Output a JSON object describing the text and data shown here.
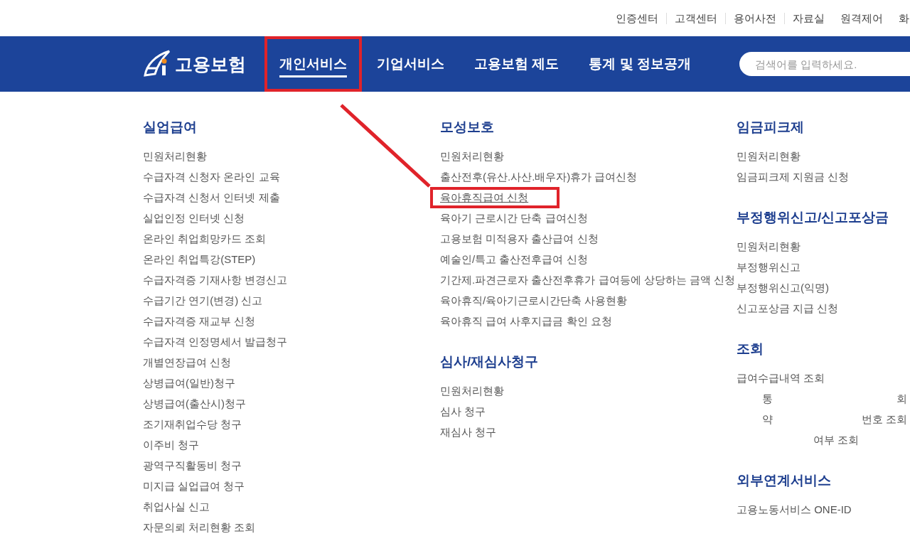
{
  "utility_links": [
    "인증센터",
    "고객센터",
    "용어사전",
    "자료실",
    "원격제어",
    "화"
  ],
  "header": {
    "logo": "고용보험",
    "nav": [
      {
        "label": "개인서비스",
        "selected": true,
        "highlighted": true
      },
      {
        "label": "기업서비스",
        "selected": false,
        "highlighted": false
      },
      {
        "label": "고용보험 제도",
        "selected": false,
        "highlighted": false
      },
      {
        "label": "통계 및 정보공개",
        "selected": false,
        "highlighted": false
      }
    ],
    "search": {
      "placeholder": "검색어를 입력하세요."
    }
  },
  "columns": [
    [
      {
        "title": "실업급여",
        "items": [
          {
            "label": "민원처리현황",
            "highlighted": false
          },
          {
            "label": "수급자격 신청자 온라인 교육",
            "highlighted": false
          },
          {
            "label": "수급자격 신청서 인터넷 제출",
            "highlighted": false
          },
          {
            "label": "실업인정 인터넷 신청",
            "highlighted": false
          },
          {
            "label": "온라인 취업희망카드 조회",
            "highlighted": false
          },
          {
            "label": "온라인 취업특강(STEP)",
            "highlighted": false
          },
          {
            "label": "수급자격증 기재사항 변경신고",
            "highlighted": false
          },
          {
            "label": "수급기간 연기(변경) 신고",
            "highlighted": false
          },
          {
            "label": "수급자격증 재교부 신청",
            "highlighted": false
          },
          {
            "label": "수급자격 인정명세서 발급청구",
            "highlighted": false
          },
          {
            "label": "개별연장급여 신청",
            "highlighted": false
          },
          {
            "label": "상병급여(일반)청구",
            "highlighted": false
          },
          {
            "label": "상병급여(출산시)청구",
            "highlighted": false
          },
          {
            "label": "조기재취업수당 청구",
            "highlighted": false
          },
          {
            "label": "이주비 청구",
            "highlighted": false
          },
          {
            "label": "광역구직활동비 청구",
            "highlighted": false
          },
          {
            "label": "미지급 실업급여 청구",
            "highlighted": false
          },
          {
            "label": "취업사실 신고",
            "highlighted": false
          },
          {
            "label": "자문의뢰 처리현황 조회",
            "highlighted": false
          }
        ]
      }
    ],
    [
      {
        "title": "모성보호",
        "items": [
          {
            "label": "민원처리현황",
            "highlighted": false
          },
          {
            "label": "출산전후(유산.사산.배우자)휴가 급여신청",
            "highlighted": false
          },
          {
            "label": "육아휴직급여 신청",
            "highlighted": true
          },
          {
            "label": "육아기 근로시간 단축 급여신청",
            "highlighted": false
          },
          {
            "label": "고용보험 미적용자 출산급여 신청",
            "highlighted": false
          },
          {
            "label": "예술인/특고 출산전후급여 신청",
            "highlighted": false
          },
          {
            "label": "기간제.파견근로자 출산전후휴가 급여등에 상당하는 금액 신청",
            "highlighted": false
          },
          {
            "label": "육아휴직/육아기근로시간단축 사용현황",
            "highlighted": false
          },
          {
            "label": "육아휴직 급여 사후지급금 확인 요청",
            "highlighted": false
          }
        ]
      },
      {
        "title": "심사/재심사청구",
        "items": [
          {
            "label": "민원처리현황",
            "highlighted": false
          },
          {
            "label": "심사 청구",
            "highlighted": false
          },
          {
            "label": "재심사 청구",
            "highlighted": false
          }
        ]
      }
    ],
    [
      {
        "title": "임금피크제",
        "items": [
          {
            "label": "민원처리현황",
            "highlighted": false
          },
          {
            "label": "임금피크제 지원금 신청",
            "highlighted": false
          }
        ]
      },
      {
        "title": "부정행위신고/신고포상금",
        "items": [
          {
            "label": "민원처리현황",
            "highlighted": false
          },
          {
            "label": "부정행위신고",
            "highlighted": false
          },
          {
            "label": "부정행위신고(익명)",
            "highlighted": false
          },
          {
            "label": "신고포상금 지급 신청",
            "highlighted": false
          }
        ]
      },
      {
        "title": "조회",
        "items": [
          {
            "label": "급여수급내역 조회",
            "highlighted": false
          },
          {
            "fragments": [
              "통",
              "회"
            ]
          },
          {
            "fragments": [
              "약",
              "번호 조회"
            ]
          },
          {
            "fragments": [
              "여부 조회"
            ]
          }
        ]
      },
      {
        "title": "외부연계서비스",
        "items": [
          {
            "label": "고용노동서비스 ONE-ID",
            "highlighted": false
          }
        ]
      }
    ]
  ]
}
